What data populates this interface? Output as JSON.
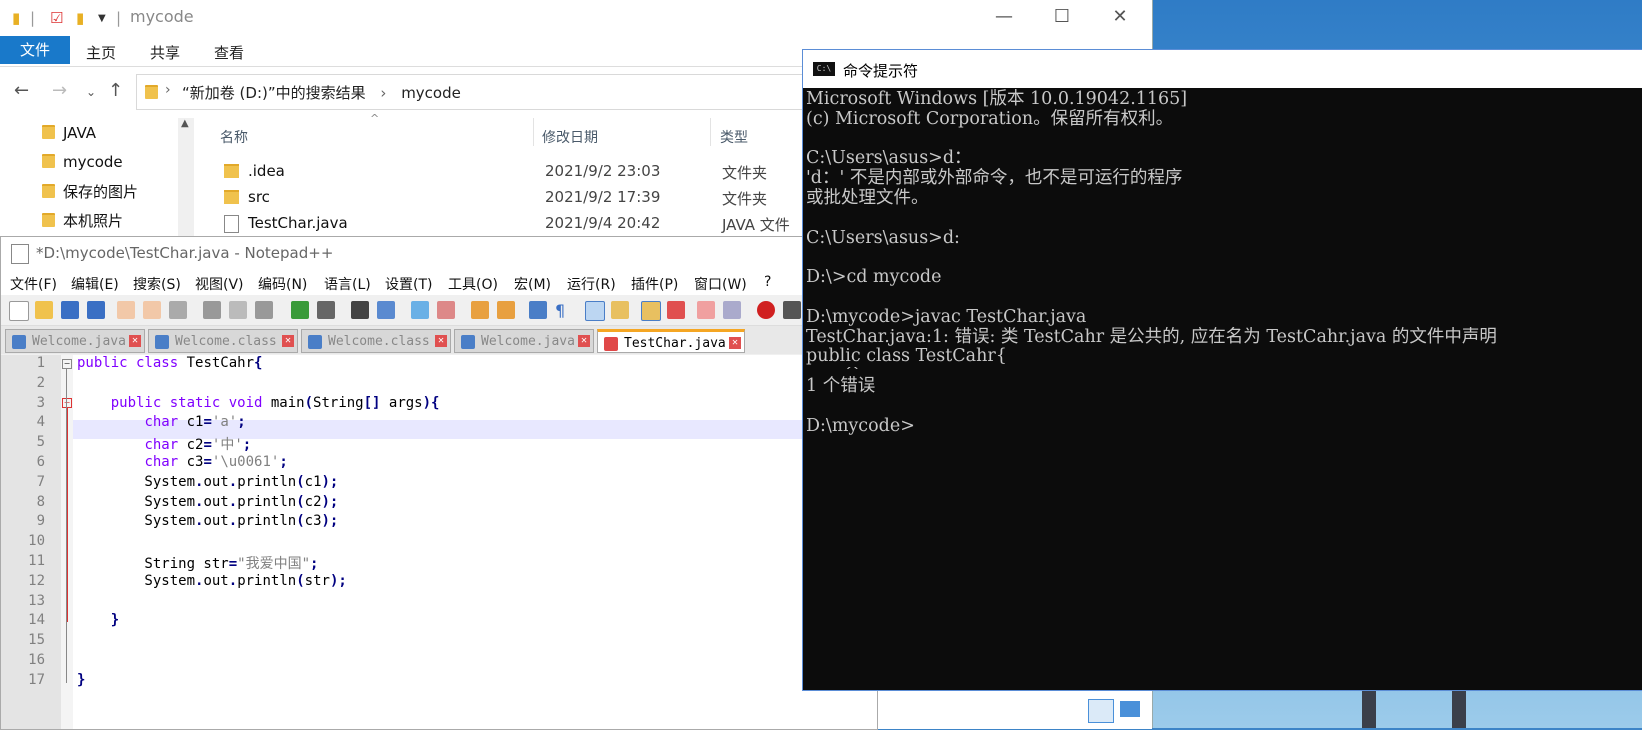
{
  "explorer": {
    "title": "mycode",
    "ribbon_tabs": {
      "file": "文件",
      "home": "主页",
      "share": "共享",
      "view": "查看"
    },
    "breadcrumb": {
      "location": "“新加卷 (D:)”中的搜索结果",
      "folder": "mycode"
    },
    "nav_items": [
      "JAVA",
      "mycode",
      "保存的图片",
      "本机照片"
    ],
    "columns": {
      "name": "名称",
      "date": "修改日期",
      "type": "类型"
    },
    "rows": [
      {
        "name": ".idea",
        "date": "2021/9/2 23:03",
        "type": "文件夹"
      },
      {
        "name": "src",
        "date": "2021/9/2 17:39",
        "type": "文件夹"
      },
      {
        "name": "TestChar.java",
        "date": "2021/9/4 20:42",
        "type": "JAVA 文件"
      }
    ]
  },
  "notepad": {
    "title": "*D:\\mycode\\TestChar.java - Notepad++",
    "menu": [
      "文件(F)",
      "编辑(E)",
      "搜索(S)",
      "视图(V)",
      "编码(N)",
      "语言(L)",
      "设置(T)",
      "工具(O)",
      "宏(M)",
      "运行(R)",
      "插件(P)",
      "窗口(W)",
      "?"
    ],
    "tabs": [
      "Welcome.java",
      "Welcome.class",
      "Welcome.class",
      "Welcome.java",
      "TestChar.java"
    ],
    "line_numbers": [
      "1",
      "2",
      "3",
      "4",
      "5",
      "6",
      "7",
      "8",
      "9",
      "10",
      "11",
      "12",
      "13",
      "14",
      "15",
      "16",
      "17"
    ]
  },
  "cmd": {
    "title": "命令提示符",
    "lines": [
      "Microsoft Windows [版本 10.0.19042.1165]",
      "(c) Microsoft Corporation。保留所有权利。",
      "",
      "C:\\Users\\asus>d：",
      "'d：' 不是内部或外部命令，也不是可运行的程序",
      "或批处理文件。",
      "",
      "C:\\Users\\asus>d:",
      "",
      "D:\\>cd mycode",
      "",
      "D:\\mycode>javac TestChar.java",
      "TestChar.java:1: 错误: 类 TestCahr 是公共的, 应在名为 TestCahr.java 的文件中声明",
      "public class TestCahr{",
      "       ^",
      "1 个错误",
      "",
      "D:\\mycode>"
    ]
  }
}
